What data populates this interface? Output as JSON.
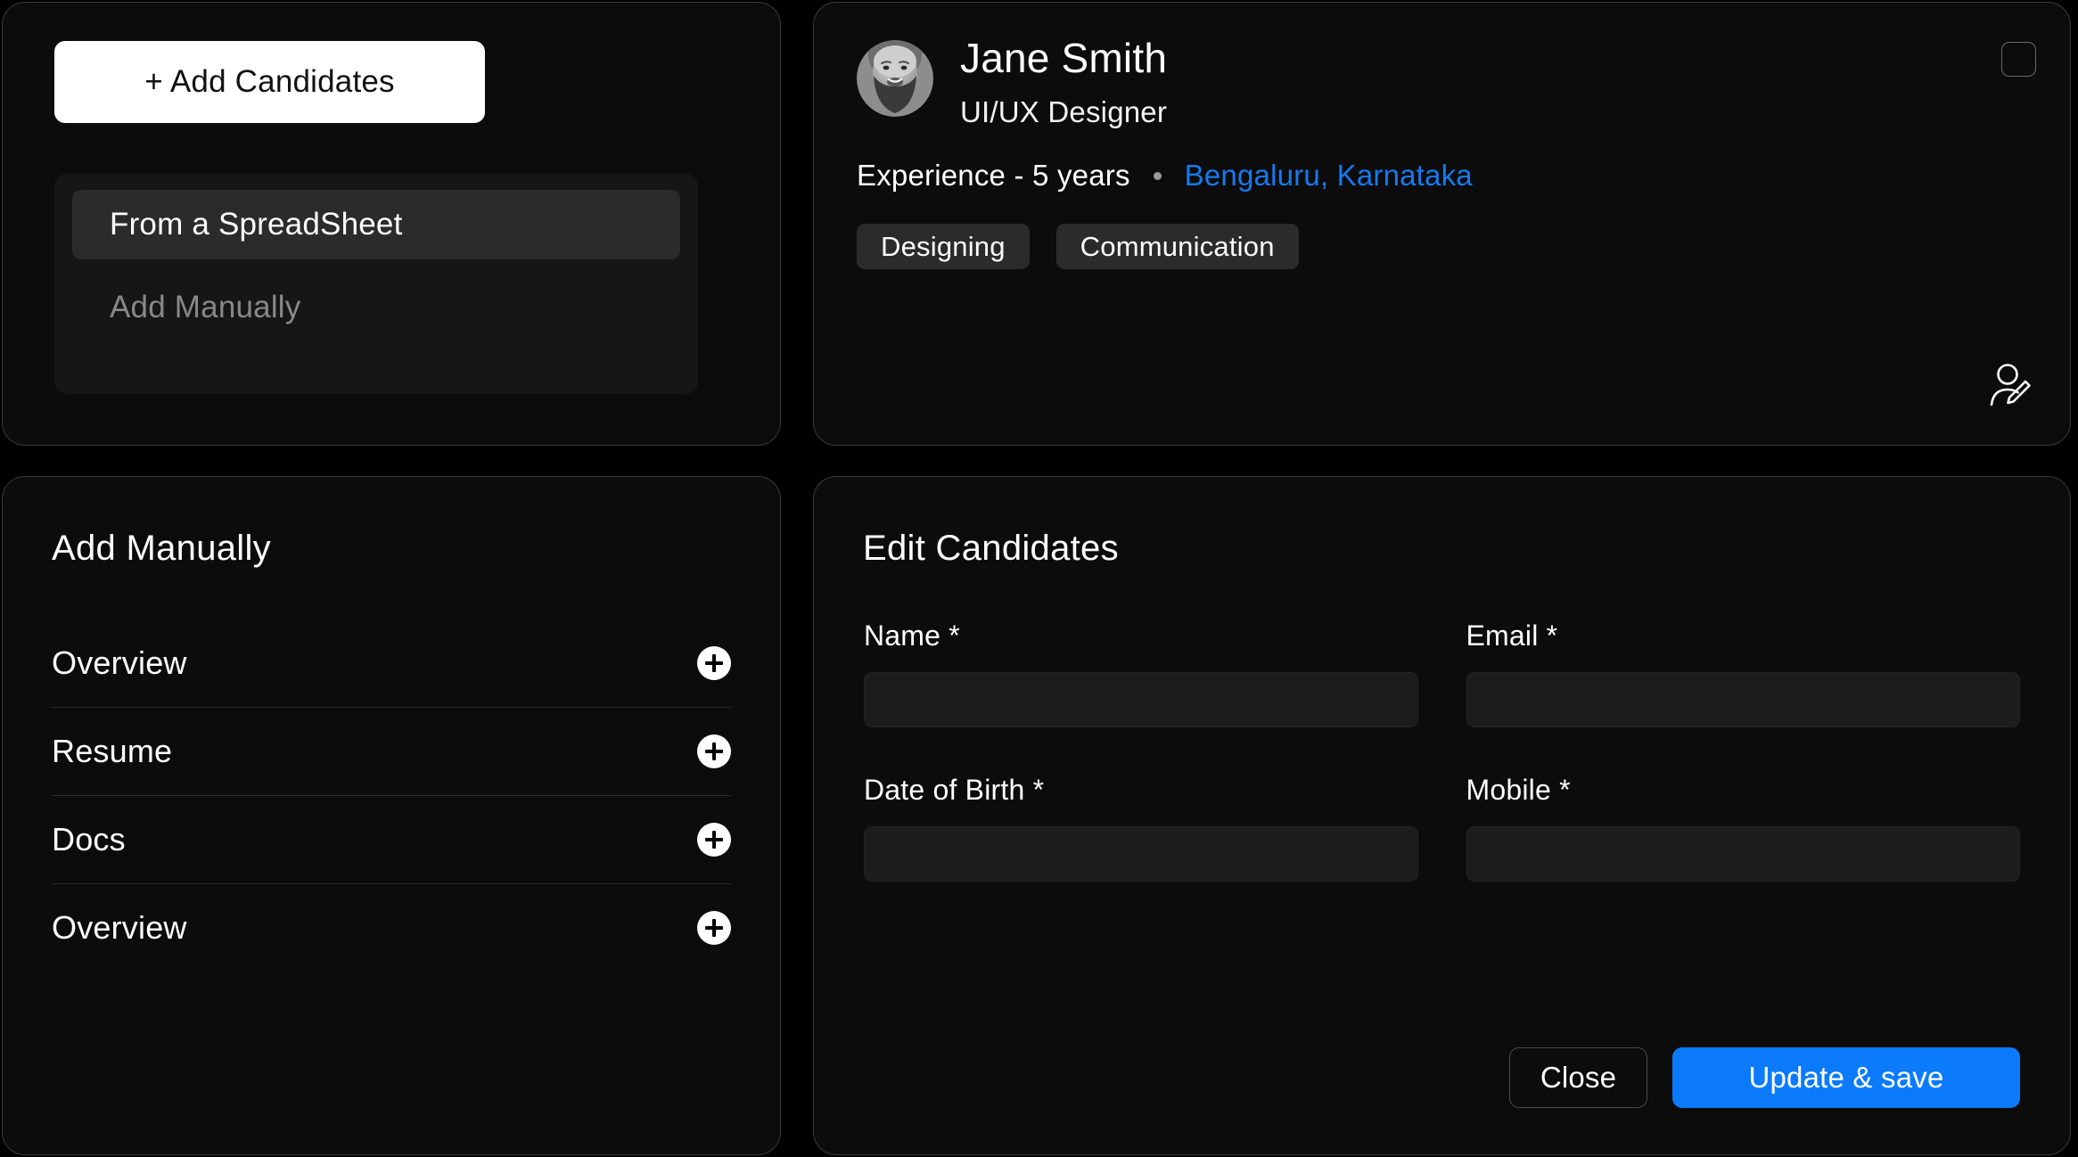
{
  "theme": {
    "background": "#000000",
    "card_background": "#0C0C0C",
    "card_border": "#3A3A3A",
    "accent_blue": "#0B7BFB",
    "link_blue": "#1779F0",
    "chip_background": "#2B2B2B",
    "input_background": "#1C1C1C",
    "muted_text": "#888888"
  },
  "add_candidates_panel": {
    "button_label": "+ Add Candidates",
    "dropdown": {
      "items": [
        {
          "label": "From a SpreadSheet",
          "selected": true
        },
        {
          "label": "Add Manually",
          "selected": false
        }
      ]
    }
  },
  "profile_panel": {
    "name": "Jane Smith",
    "role": "UI/UX Designer",
    "experience": "Experience - 5 years",
    "separator": "•",
    "location": "Bengaluru, Karnataka",
    "skills": [
      "Designing",
      "Communication"
    ],
    "select_checkbox_checked": false,
    "icons": {
      "select": "checkbox-icon",
      "edit_profile": "user-edit-icon",
      "avatar": "avatar-photo"
    }
  },
  "add_manually_panel": {
    "title": "Add Manually",
    "sections": [
      {
        "label": "Overview",
        "action_icon": "plus-icon"
      },
      {
        "label": "Resume",
        "action_icon": "plus-icon"
      },
      {
        "label": "Docs",
        "action_icon": "plus-icon"
      },
      {
        "label": "Overview",
        "action_icon": "plus-icon"
      }
    ]
  },
  "edit_candidates_panel": {
    "title": "Edit Candidates",
    "fields": [
      {
        "label": "Name",
        "required_mark": "*",
        "value": "",
        "placeholder": ""
      },
      {
        "label": "Email",
        "required_mark": "*",
        "value": "",
        "placeholder": ""
      },
      {
        "label": "Date of Birth",
        "required_mark": "*",
        "value": "",
        "placeholder": ""
      },
      {
        "label": "Mobile",
        "required_mark": "*",
        "value": "",
        "placeholder": ""
      }
    ],
    "actions": {
      "close_label": "Close",
      "primary_label": "Update & save"
    }
  }
}
